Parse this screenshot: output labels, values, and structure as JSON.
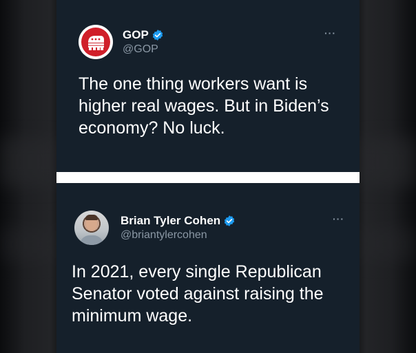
{
  "tweets": [
    {
      "name": "GOP",
      "handle": "@GOP",
      "more": "···",
      "text": "The one thing workers want is higher real wages. But in Biden’s economy? No luck."
    },
    {
      "name": "Brian Tyler Cohen",
      "handle": "@briantylercohen",
      "more": "···",
      "text": "In 2021, every single Republican Senator voted against raising the minimum wage."
    }
  ],
  "colors": {
    "card_bg": "#15202b",
    "verified": "#1d9bf0",
    "gop_red": "#d01f2a",
    "handle_gray": "#8b98a5"
  }
}
